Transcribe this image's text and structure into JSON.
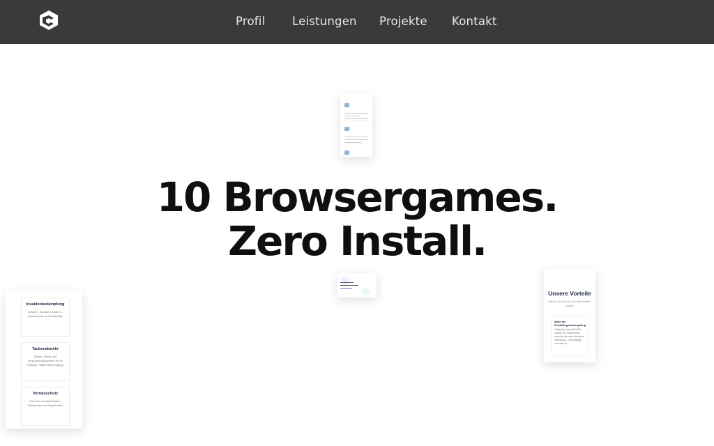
{
  "nav": {
    "items": [
      {
        "label": "Profil"
      },
      {
        "label": "Leistungen"
      },
      {
        "label": "Projekte"
      },
      {
        "label": "Kontakt"
      }
    ]
  },
  "hero": {
    "line1": "10 Browsergames.",
    "line2": "Zero Install."
  },
  "left_card": {
    "items": [
      {
        "title": "Insektenbekämpfung",
        "text": "Wespen, Schaben, Milben – professionell und nachhaltig."
      },
      {
        "title": "Taubenabwehr",
        "text": "Spikes, Netze und Vergrämungssysteme für Ihr Fassade. Taubenkotreinigung."
      },
      {
        "title": "Vorratsschutz",
        "text": "Für Lebensmittelbetriebe, Bäckereien und Lagerhallen"
      }
    ]
  },
  "right_card": {
    "title": "Unsere Vorteile",
    "subtitle": "Warum Sie sich für uns entscheiden sollten",
    "box_title": "Mehr als Schädlingsbekämpfung",
    "box_text": "Zertifiziert nach DIN EN 16636. Als Fachbetrieb arbeiten wir nach aktuellen Standards – zuverlässig und diskret."
  },
  "colors": {
    "topbar": "#3a3a3a",
    "nav_text": "#e9e9e9",
    "hero_text": "#0f0f0f"
  }
}
